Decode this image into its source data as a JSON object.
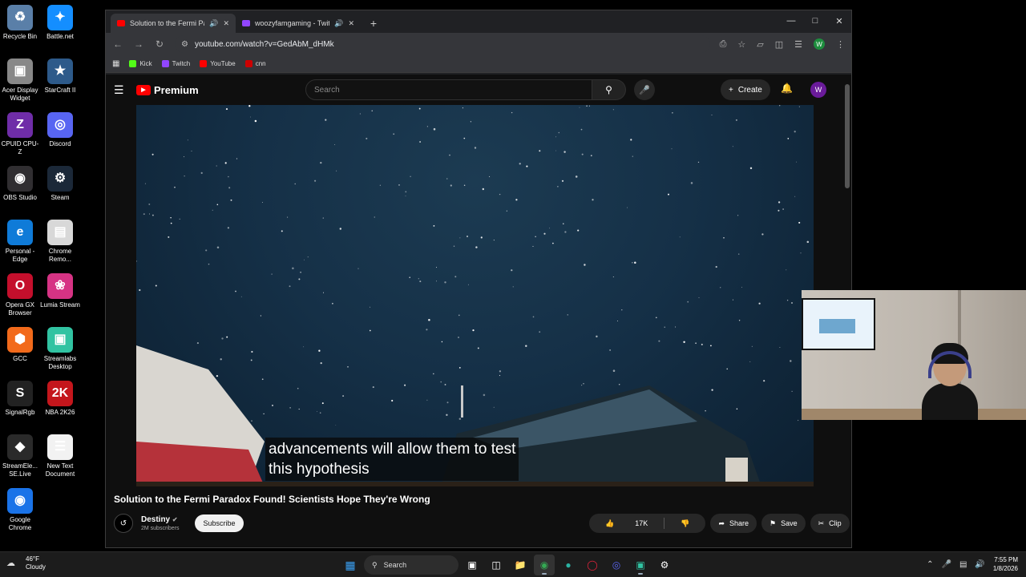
{
  "desktop": {
    "icons": [
      {
        "label": "Recycle Bin",
        "glyph": "♻",
        "color": "#5a7fa8"
      },
      {
        "label": "Battle.net",
        "glyph": "✦",
        "color": "#148eff"
      },
      {
        "label": "Acer Display Widget",
        "glyph": "▣",
        "color": "#888888"
      },
      {
        "label": "StarCraft II",
        "glyph": "★",
        "color": "#2d5a8a"
      },
      {
        "label": "CPUID CPU-Z",
        "glyph": "Z",
        "color": "#6f2da8"
      },
      {
        "label": "Discord",
        "glyph": "◎",
        "color": "#5865f2"
      },
      {
        "label": "OBS Studio",
        "glyph": "◉",
        "color": "#302e31"
      },
      {
        "label": "Steam",
        "glyph": "⚙",
        "color": "#1b2838"
      },
      {
        "label": "Personal - Edge",
        "glyph": "e",
        "color": "#0f7bd8"
      },
      {
        "label": "Chrome Remo...",
        "glyph": "▤",
        "color": "#d8d8d8"
      },
      {
        "label": "Opera GX Browser",
        "glyph": "O",
        "color": "#c40f2c"
      },
      {
        "label": "Lumia Stream",
        "glyph": "❀",
        "color": "#d63384"
      },
      {
        "label": "GCC",
        "glyph": "⬢",
        "color": "#f26a1b"
      },
      {
        "label": "Streamlabs Desktop",
        "glyph": "▣",
        "color": "#31c3a2"
      },
      {
        "label": "SignalRgb",
        "glyph": "S",
        "color": "#222222"
      },
      {
        "label": "NBA 2K26",
        "glyph": "2K",
        "color": "#c4161c"
      },
      {
        "label": "StreamEle... SE.Live",
        "glyph": "◆",
        "color": "#2a2a2a"
      },
      {
        "label": "New Text Document",
        "glyph": "☰",
        "color": "#f2f2f2"
      },
      {
        "label": "Google Chrome",
        "glyph": "◉",
        "color": "#1a73e8"
      }
    ]
  },
  "browser": {
    "tabs": [
      {
        "title": "Solution to the Fermi Parad",
        "favicon_color": "#ff0000",
        "active": true
      },
      {
        "title": "woozyfamgaming - Twitch",
        "favicon_color": "#9146ff",
        "active": false
      }
    ],
    "url": "youtube.com/watch?v=GedAbM_dHMk",
    "bookmarks": [
      {
        "label": "Kick",
        "color": "#53fc18"
      },
      {
        "label": "Twitch",
        "color": "#9146ff"
      },
      {
        "label": "YouTube",
        "color": "#ff0000"
      },
      {
        "label": "cnn",
        "color": "#cc0000"
      }
    ],
    "profile_initial": "W"
  },
  "youtube": {
    "logo_text": "Premium",
    "search_placeholder": "Search",
    "create_label": "Create",
    "avatar_initial": "W",
    "caption_line1": "advancements will allow them to test",
    "caption_line2": "this hypothesis",
    "video_title": "Solution to the Fermi Paradox Found! Scientists Hope They're Wrong",
    "channel_name": "Destiny",
    "channel_subs": "2M subscribers",
    "subscribe_label": "Subscribe",
    "likes": "17K",
    "share_label": "Share",
    "save_label": "Save",
    "clip_label": "Clip"
  },
  "taskbar": {
    "temperature": "46°F",
    "weather": "Cloudy",
    "search_label": "Search",
    "time": "7:55 PM",
    "date": "1/8/2026"
  }
}
